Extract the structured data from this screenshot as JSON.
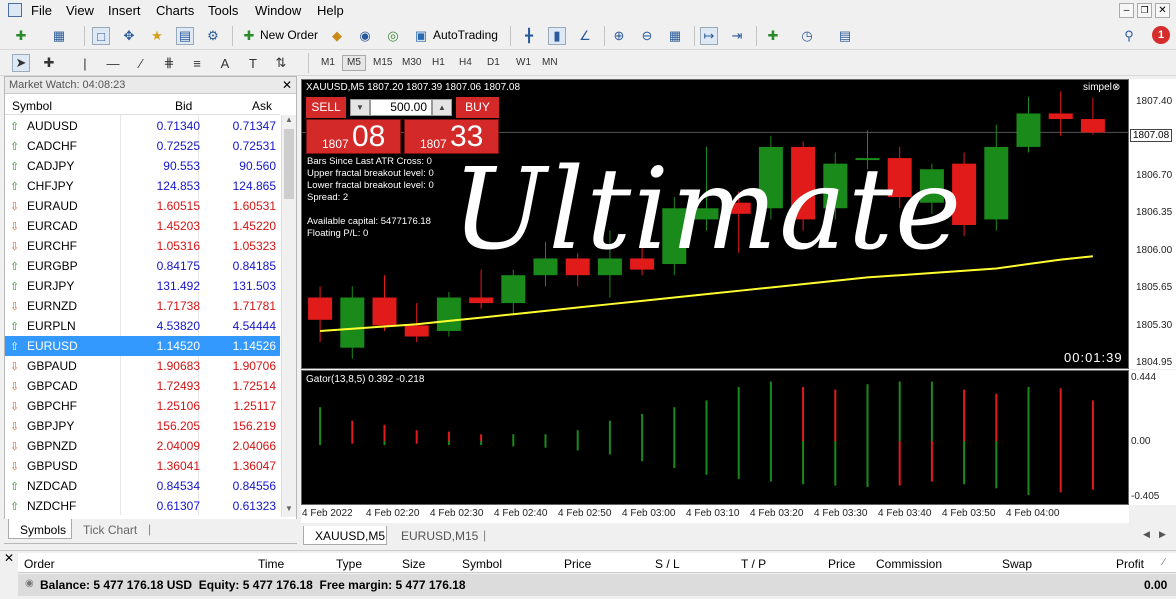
{
  "menu": [
    "File",
    "View",
    "Insert",
    "Charts",
    "Tools",
    "Window",
    "Help"
  ],
  "toolbar": {
    "new_order": "New Order",
    "autotrading": "AutoTrading",
    "notif_count": "1"
  },
  "timeframes": [
    "M1",
    "M5",
    "M15",
    "M30",
    "H1",
    "H4",
    "D1",
    "W1",
    "MN"
  ],
  "active_timeframe": "M5",
  "market_watch": {
    "title": "Market Watch: 04:08:23",
    "headers": {
      "symbol": "Symbol",
      "bid": "Bid",
      "ask": "Ask"
    },
    "rows": [
      {
        "symbol": "AUDUSD",
        "bid": "0.71340",
        "ask": "0.71347",
        "dir": "up"
      },
      {
        "symbol": "CADCHF",
        "bid": "0.72525",
        "ask": "0.72531",
        "dir": "up"
      },
      {
        "symbol": "CADJPY",
        "bid": "90.553",
        "ask": "90.560",
        "dir": "up"
      },
      {
        "symbol": "CHFJPY",
        "bid": "124.853",
        "ask": "124.865",
        "dir": "up"
      },
      {
        "symbol": "EURAUD",
        "bid": "1.60515",
        "ask": "1.60531",
        "dir": "down"
      },
      {
        "symbol": "EURCAD",
        "bid": "1.45203",
        "ask": "1.45220",
        "dir": "down"
      },
      {
        "symbol": "EURCHF",
        "bid": "1.05316",
        "ask": "1.05323",
        "dir": "down"
      },
      {
        "symbol": "EURGBP",
        "bid": "0.84175",
        "ask": "0.84185",
        "dir": "up"
      },
      {
        "symbol": "EURJPY",
        "bid": "131.492",
        "ask": "131.503",
        "dir": "up"
      },
      {
        "symbol": "EURNZD",
        "bid": "1.71738",
        "ask": "1.71781",
        "dir": "down"
      },
      {
        "symbol": "EURPLN",
        "bid": "4.53820",
        "ask": "4.54444",
        "dir": "up"
      },
      {
        "symbol": "EURUSD",
        "bid": "1.14520",
        "ask": "1.14526",
        "dir": "up",
        "selected": true
      },
      {
        "symbol": "GBPAUD",
        "bid": "1.90683",
        "ask": "1.90706",
        "dir": "down"
      },
      {
        "symbol": "GBPCAD",
        "bid": "1.72493",
        "ask": "1.72514",
        "dir": "down"
      },
      {
        "symbol": "GBPCHF",
        "bid": "1.25106",
        "ask": "1.25117",
        "dir": "down"
      },
      {
        "symbol": "GBPJPY",
        "bid": "156.205",
        "ask": "156.219",
        "dir": "down"
      },
      {
        "symbol": "GBPNZD",
        "bid": "2.04009",
        "ask": "2.04066",
        "dir": "down"
      },
      {
        "symbol": "GBPUSD",
        "bid": "1.36041",
        "ask": "1.36047",
        "dir": "down"
      },
      {
        "symbol": "NZDCAD",
        "bid": "0.84534",
        "ask": "0.84556",
        "dir": "up"
      },
      {
        "symbol": "NZDCHF",
        "bid": "0.61307",
        "ask": "0.61323",
        "dir": "up"
      }
    ],
    "tabs": [
      "Symbols",
      "Tick Chart"
    ]
  },
  "chart": {
    "header": "XAUUSD,M5  1807.20 1807.39 1807.06 1807.08",
    "simpel": "simpel",
    "sell": "SELL",
    "buy": "BUY",
    "lot": "500.00",
    "sell_price_small": "1807",
    "sell_price_big": "08",
    "buy_price_small": "1807",
    "buy_price_big": "33",
    "info": [
      "Bars Since Last ATR Cross: 0",
      "Upper fractal breakout level: 0",
      "Lower fractal breakout level: 0",
      "Spread: 2",
      "",
      "Available capital: 5477176.18",
      "Floating P/L: 0"
    ],
    "watermark": "Ultimate",
    "timer": "00:01:39",
    "price_labels": [
      "1807.40",
      "1807.08",
      "1806.70",
      "1806.35",
      "1806.00",
      "1805.65",
      "1805.30",
      "1804.95"
    ],
    "current_price": "1807.08",
    "indicator_label": "Gator(13,8,5) 0.392 -0.218",
    "indicator_axis": [
      "0.444",
      "0.00",
      "-0.405"
    ],
    "time_labels": [
      "4 Feb 2022",
      "4 Feb 02:20",
      "4 Feb 02:30",
      "4 Feb 02:40",
      "4 Feb 02:50",
      "4 Feb 03:00",
      "4 Feb 03:10",
      "4 Feb 03:20",
      "4 Feb 03:30",
      "4 Feb 03:40",
      "4 Feb 03:50",
      "4 Feb 04:00"
    ],
    "tabs": [
      "XAUUSD,M5",
      "EURUSD,M15"
    ],
    "colors": {
      "bull": "#1a8a1a",
      "bear": "#e11a1a",
      "ma": "#ffff30"
    }
  },
  "chart_data": {
    "type": "candlestick",
    "candles": [
      {
        "o": 1805.6,
        "h": 1805.7,
        "l": 1805.2,
        "c": 1805.4
      },
      {
        "o": 1805.15,
        "h": 1805.7,
        "l": 1805.05,
        "c": 1805.6
      },
      {
        "o": 1805.6,
        "h": 1805.8,
        "l": 1805.3,
        "c": 1805.35
      },
      {
        "o": 1805.35,
        "h": 1805.55,
        "l": 1805.2,
        "c": 1805.25
      },
      {
        "o": 1805.3,
        "h": 1805.65,
        "l": 1805.25,
        "c": 1805.6
      },
      {
        "o": 1805.6,
        "h": 1805.85,
        "l": 1805.5,
        "c": 1805.55
      },
      {
        "o": 1805.55,
        "h": 1805.85,
        "l": 1805.45,
        "c": 1805.8
      },
      {
        "o": 1805.8,
        "h": 1806.1,
        "l": 1805.7,
        "c": 1805.95
      },
      {
        "o": 1805.95,
        "h": 1806.0,
        "l": 1805.7,
        "c": 1805.8
      },
      {
        "o": 1805.8,
        "h": 1806.2,
        "l": 1805.6,
        "c": 1805.95
      },
      {
        "o": 1805.95,
        "h": 1806.2,
        "l": 1805.8,
        "c": 1805.85
      },
      {
        "o": 1805.9,
        "h": 1806.5,
        "l": 1805.8,
        "c": 1806.4
      },
      {
        "o": 1806.3,
        "h": 1806.95,
        "l": 1806.2,
        "c": 1806.4
      },
      {
        "o": 1806.45,
        "h": 1806.55,
        "l": 1806.0,
        "c": 1806.35
      },
      {
        "o": 1806.4,
        "h": 1807.05,
        "l": 1806.3,
        "c": 1806.95
      },
      {
        "o": 1806.95,
        "h": 1807.0,
        "l": 1806.2,
        "c": 1806.3
      },
      {
        "o": 1806.4,
        "h": 1806.9,
        "l": 1806.3,
        "c": 1806.8
      },
      {
        "o": 1806.85,
        "h": 1807.1,
        "l": 1806.75,
        "c": 1806.85
      },
      {
        "o": 1806.85,
        "h": 1806.95,
        "l": 1806.4,
        "c": 1806.5
      },
      {
        "o": 1806.45,
        "h": 1806.8,
        "l": 1806.35,
        "c": 1806.75
      },
      {
        "o": 1806.8,
        "h": 1806.9,
        "l": 1806.15,
        "c": 1806.25
      },
      {
        "o": 1806.3,
        "h": 1807.15,
        "l": 1806.2,
        "c": 1806.95
      },
      {
        "o": 1806.95,
        "h": 1807.4,
        "l": 1806.9,
        "c": 1807.25
      },
      {
        "o": 1807.25,
        "h": 1807.45,
        "l": 1807.05,
        "c": 1807.2
      },
      {
        "o": 1807.2,
        "h": 1807.39,
        "l": 1807.06,
        "c": 1807.08
      }
    ],
    "ma": [
      1805.3,
      1805.32,
      1805.34,
      1805.36,
      1805.39,
      1805.42,
      1805.45,
      1805.48,
      1805.51,
      1805.54,
      1805.57,
      1805.6,
      1805.63,
      1805.66,
      1805.69,
      1805.72,
      1805.75,
      1805.78,
      1805.8,
      1805.82,
      1805.84,
      1805.86,
      1805.9,
      1805.94,
      1805.97
    ],
    "gator_upper": [
      0.25,
      0.15,
      0.12,
      0.08,
      0.07,
      0.05,
      0.05,
      0.05,
      0.08,
      0.15,
      0.2,
      0.25,
      0.3,
      0.4,
      0.44,
      0.4,
      0.38,
      0.42,
      0.44,
      0.44,
      0.38,
      0.35,
      0.4,
      0.39,
      0.3
    ],
    "gator_lower": [
      -0.03,
      -0.02,
      -0.03,
      -0.02,
      -0.03,
      -0.03,
      -0.04,
      -0.05,
      -0.07,
      -0.1,
      -0.15,
      -0.2,
      -0.25,
      -0.28,
      -0.3,
      -0.32,
      -0.33,
      -0.34,
      -0.33,
      -0.3,
      -0.32,
      -0.35,
      -0.4,
      -0.38,
      -0.36
    ],
    "ylim": [
      1804.95,
      1807.55
    ]
  },
  "terminal": {
    "headers": [
      "Order",
      "Time",
      "Type",
      "Size",
      "Symbol",
      "Price",
      "S / L",
      "T / P",
      "Price",
      "Commission",
      "Swap",
      "Profit"
    ],
    "balance_text": "Balance: 5 477 176.18 USD  Equity: 5 477 176.18  Free margin: 5 477 176.18",
    "profit": "0.00"
  }
}
